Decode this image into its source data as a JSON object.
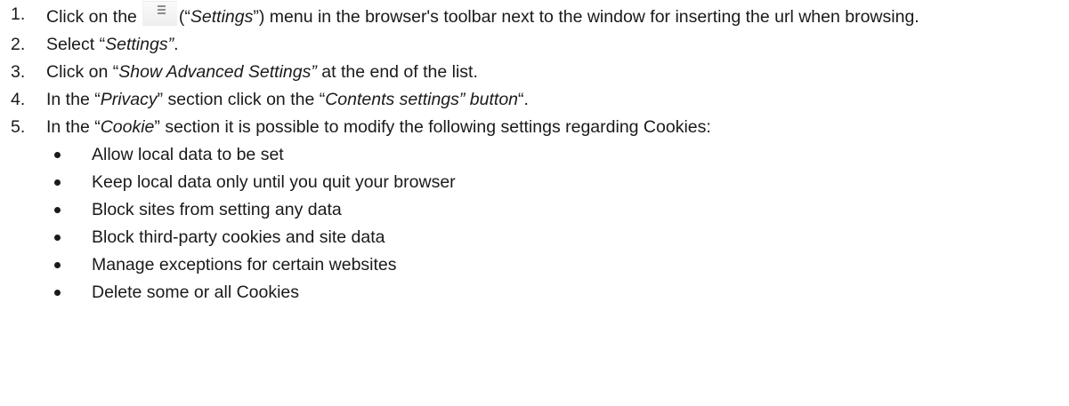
{
  "steps": [
    {
      "number": "1.",
      "before_icon": "Click on the",
      "icon": "menu-icon",
      "paren_open": "(“",
      "italic": "Settings",
      "after": "”) menu in the browser's toolbar next to the window for inserting the url when browsing."
    },
    {
      "number": "2.",
      "before": "Select “",
      "italic": "Settings”",
      "after": "."
    },
    {
      "number": "3.",
      "before": "Click on “",
      "italic": "Show Advanced Settings”",
      "after": " at the end of the list."
    },
    {
      "number": "4.",
      "before": "In the “",
      "italic": "Privacy",
      "middle": "” section click on the “",
      "italic2": "Contents settings” button",
      "after": "“."
    },
    {
      "number": "5.",
      "before": "In the “",
      "italic": "Cookie",
      "after": "” section it is possible to modify the following settings regarding Cookies:"
    }
  ],
  "bullets": [
    "Allow local data to be set",
    "Keep local data only until you quit your browser",
    "Block sites from setting any data",
    "Block third-party cookies and site data",
    "Manage exceptions for certain websites",
    "Delete some or all Cookies"
  ]
}
